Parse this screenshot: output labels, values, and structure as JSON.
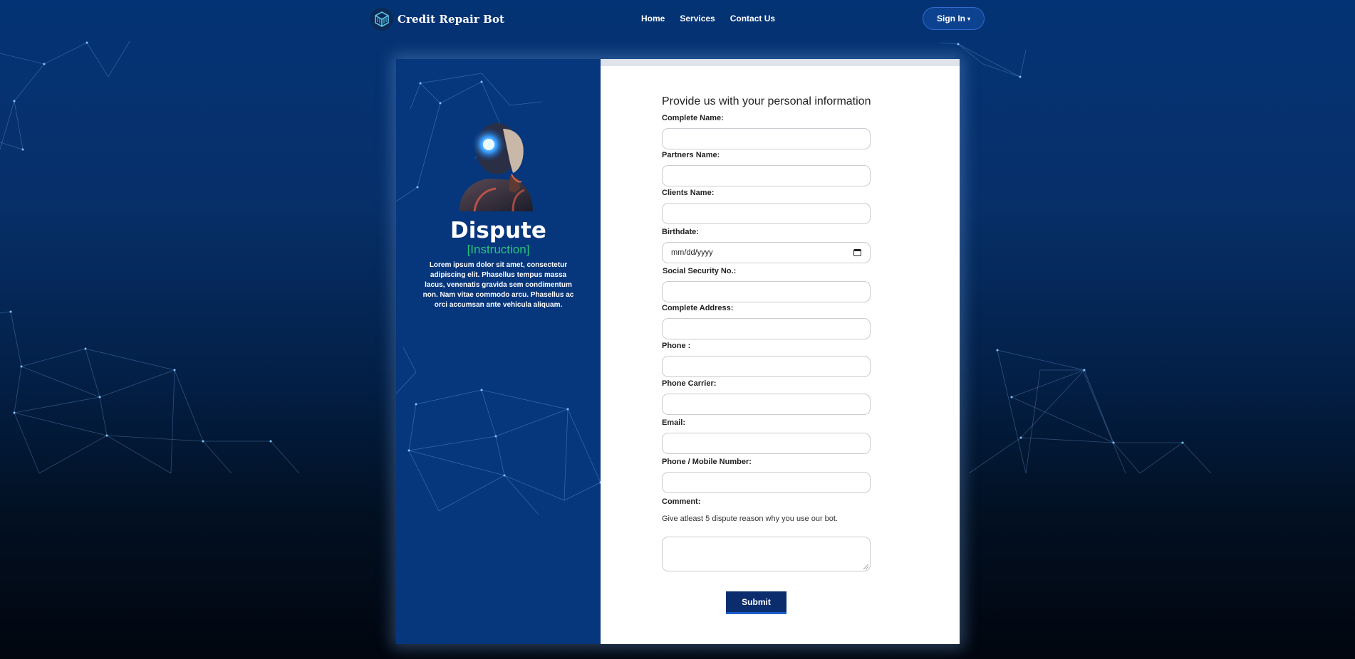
{
  "header": {
    "brand": "Credit Repair Bot",
    "nav": [
      "Home",
      "Services",
      "Contact Us"
    ],
    "signin_label": "Sign In",
    "signin_caret": "▾"
  },
  "intro": {
    "title": "Dispute",
    "subtitle": "[Instruction]",
    "description": "Lorem ipsum dolor sit amet, consectetur adipiscing elit. Phasellus tempus massa lacus, venenatis gravida sem condimentum non. Nam vitae commodo arcu. Phasellus ac orci accumsan ante vehicula aliquam."
  },
  "form": {
    "title": "Provide us with your personal information",
    "labels": {
      "complete_name": "Complete Name:",
      "partners_name": "Partners Name:",
      "clients_name": "Clients Name:",
      "birthdate": "Birthdate:",
      "ssn": "Social Security No.:",
      "address": "Complete Address:",
      "phone": "Phone :",
      "carrier": "Phone Carrier:",
      "email": "Email:",
      "mobile": "Phone / Mobile Number:",
      "comment": "Comment:"
    },
    "birthdate_placeholder": "mm/dd/yyyy",
    "comment_hint": "Give atleast 5 dispute reason why you use our bot.",
    "submit_label": "Submit"
  },
  "icons": {
    "brand_logo": "cube-logo-icon",
    "date_picker": "calendar-icon",
    "avatar": "robot-thinking-image"
  },
  "colors": {
    "primary": "#06367c",
    "accent_green": "#27c57d",
    "submit_bg": "#0b2d6e"
  }
}
